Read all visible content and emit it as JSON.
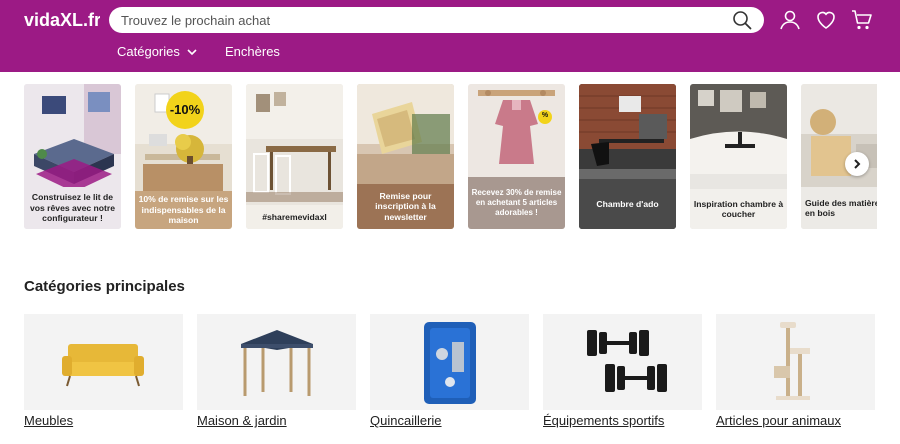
{
  "header": {
    "logo_text": "vidaXL.fr",
    "search": {
      "placeholder": "Trouvez le prochain achat",
      "value": ""
    },
    "icons": [
      "search-icon",
      "user-icon",
      "heart-icon",
      "cart-icon"
    ]
  },
  "nav": {
    "items": [
      {
        "label": "Catégories",
        "has_dropdown": true
      },
      {
        "label": "Enchères"
      }
    ]
  },
  "banners": [
    {
      "caption": "Construisez le lit de vos rêves avec notre configurateur !"
    },
    {
      "caption": "10% de remise sur les indispensables de la maison",
      "badge": "-10%"
    },
    {
      "caption": "#sharemevidaxl"
    },
    {
      "caption": "Remise pour inscription à la newsletter"
    },
    {
      "caption": "Recevez 30% de remise en achetant 5 articles adorables !",
      "badge": "%"
    },
    {
      "caption": "Chambre d'ado"
    },
    {
      "caption": "Inspiration chambre à coucher"
    },
    {
      "caption": "Guide des matières en bois"
    }
  ],
  "categories_section": {
    "title": "Catégories principales",
    "items": [
      {
        "label": "Meubles"
      },
      {
        "label": "Maison & jardin"
      },
      {
        "label": "Quincaillerie"
      },
      {
        "label": "Équipements sportifs"
      },
      {
        "label": "Articles pour animaux"
      }
    ]
  },
  "colors": {
    "brand": "#9c1a85",
    "white": "#ffffff",
    "badge_yellow": "#f2d31a"
  }
}
